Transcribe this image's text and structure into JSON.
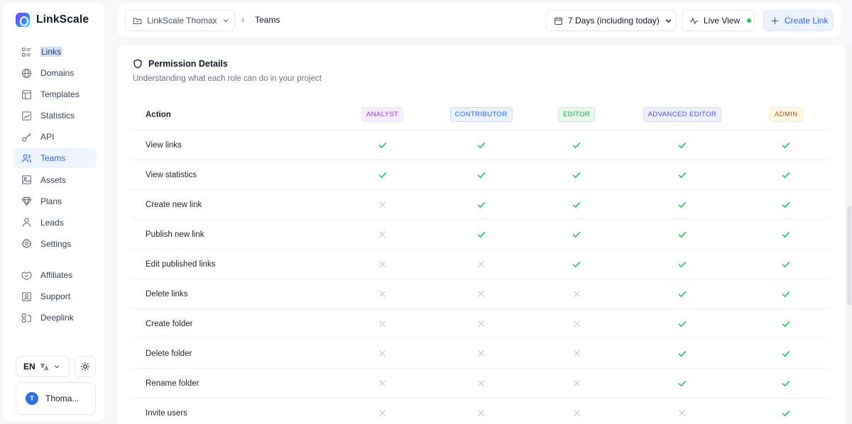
{
  "brand": {
    "name": "LinkScale"
  },
  "sidebar": {
    "items": [
      {
        "label": "Links",
        "icon": "links-icon"
      },
      {
        "label": "Domains",
        "icon": "globe-icon"
      },
      {
        "label": "Templates",
        "icon": "layout-icon"
      },
      {
        "label": "Statistics",
        "icon": "chart-icon"
      },
      {
        "label": "API",
        "icon": "key-icon"
      },
      {
        "label": "Teams",
        "icon": "users-icon",
        "active": true
      },
      {
        "label": "Assets",
        "icon": "image-icon"
      },
      {
        "label": "Plans",
        "icon": "gem-icon"
      },
      {
        "label": "Leads",
        "icon": "user-icon"
      },
      {
        "label": "Settings",
        "icon": "gear-icon"
      }
    ],
    "secondary": [
      {
        "label": "Affiliates",
        "icon": "handshake-icon"
      },
      {
        "label": "Support",
        "icon": "support-icon"
      },
      {
        "label": "Deeplink",
        "icon": "deeplink-icon"
      }
    ],
    "language": "EN",
    "user": {
      "initial": "T",
      "name": "Thoma..."
    }
  },
  "topbar": {
    "project": "LinkScale Thomax",
    "breadcrumb_sep": "›",
    "breadcrumb": "Teams",
    "date_range": "7 Days (including today)",
    "live_view": "Live View",
    "create_link": "Create Link"
  },
  "permissions": {
    "title": "Permission Details",
    "subtitle": "Understanding what each role can do in your project",
    "action_header": "Action",
    "roles": [
      "ANALYST",
      "CONTRIBUTOR",
      "EDITOR",
      "ADVANCED EDITOR",
      "ADMIN"
    ],
    "rows": [
      {
        "action": "View links",
        "allowed": [
          true,
          true,
          true,
          true,
          true
        ]
      },
      {
        "action": "View statistics",
        "allowed": [
          true,
          true,
          true,
          true,
          true
        ]
      },
      {
        "action": "Create new link",
        "allowed": [
          false,
          true,
          true,
          true,
          true
        ]
      },
      {
        "action": "Publish new link",
        "allowed": [
          false,
          true,
          true,
          true,
          true
        ]
      },
      {
        "action": "Edit published links",
        "allowed": [
          false,
          false,
          true,
          true,
          true
        ]
      },
      {
        "action": "Delete links",
        "allowed": [
          false,
          false,
          false,
          true,
          true
        ]
      },
      {
        "action": "Create folder",
        "allowed": [
          false,
          false,
          false,
          true,
          true
        ]
      },
      {
        "action": "Delete folder",
        "allowed": [
          false,
          false,
          false,
          true,
          true
        ]
      },
      {
        "action": "Rename folder",
        "allowed": [
          false,
          false,
          false,
          true,
          true
        ]
      },
      {
        "action": "Invite users",
        "allowed": [
          false,
          false,
          false,
          false,
          true
        ]
      }
    ]
  },
  "colors": {
    "accent": "#2563eb",
    "check": "#22c55e",
    "cross": "#c9ccd2",
    "live_dot": "#22c55e"
  }
}
